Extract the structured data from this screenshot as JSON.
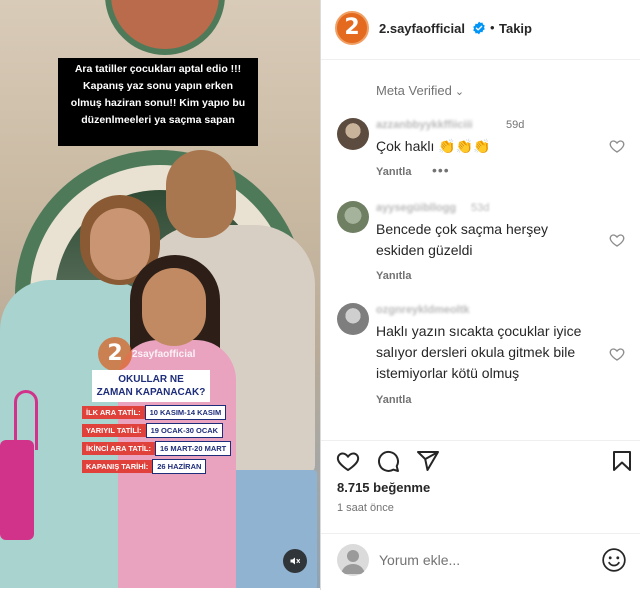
{
  "post": {
    "overlay_caption": [
      "Ara tatiller çocukları aptal edio !!!",
      "Kapanış yaz sonu yapın erken",
      "olmuş haziran sonu!! Kim yapıo bu",
      "düzenlmeeleri ya saçma sapan"
    ],
    "watermark_logo": "2",
    "watermark_text": "2sayfaofficial",
    "school_card": {
      "title_line1": "OKULLAR NE",
      "title_line2": "ZAMAN KAPANACAK?",
      "rows": [
        {
          "label": "İLK ARA TATİL:",
          "value": "10 KASIM-14 KASIM"
        },
        {
          "label": "YARIYIL TATİLİ:",
          "value": "19 OCAK-30 OCAK"
        },
        {
          "label": "İKİNCİ ARA TATİL:",
          "value": "16 MART-20 MART"
        },
        {
          "label": "KAPANIŞ TARİHİ:",
          "value": "26 HAZİRAN"
        }
      ]
    },
    "mute_icon": "speaker-muted-icon"
  },
  "header": {
    "logo_glyph": "2",
    "username": "2.sayfaofficial",
    "separator": "•",
    "follow_label": "Takip",
    "verified_color": "#0095f6"
  },
  "meta_verified": "Meta Verified",
  "comments": [
    {
      "username": "azzanbbyykkffiiciii",
      "time": "59d",
      "text": "Çok haklı 👏👏👏",
      "reply": "Yanıtla",
      "more": "•••"
    },
    {
      "username": "ayysegüibllogg",
      "time": "53d",
      "text": "Bencede çok saçma herşey eskiden güzeldi",
      "reply": "Yanıtla"
    },
    {
      "username": "ozgnreykldmeoltk",
      "time": "",
      "text": "Haklı yazın sıcakta çocuklar iyice salıyor dersleri okula gitmek bile istemiyorlar kötü olmuş",
      "reply": "Yanıtla"
    }
  ],
  "actions": {
    "icons": [
      "heart-icon",
      "comment-icon",
      "share-icon",
      "bookmark-icon"
    ]
  },
  "likes": "8.715 beğenme",
  "time_ago": "1 saat önce",
  "add_comment": {
    "placeholder": "Yorum ekle...",
    "emoji_icon": "emoji-icon"
  }
}
